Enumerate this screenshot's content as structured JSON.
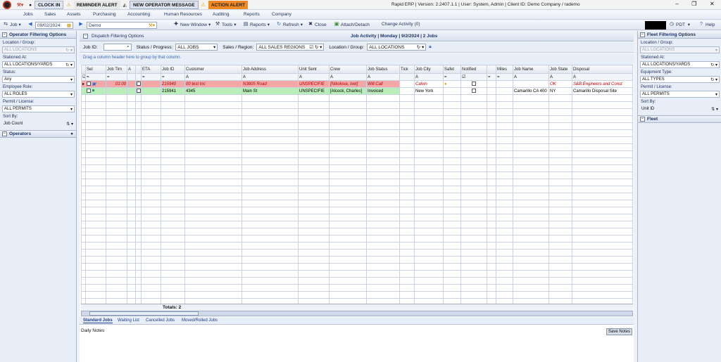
{
  "alerts": {
    "clock_in": "CLOCK IN",
    "reminder": "REMINDER ALERT",
    "new_operator": "NEW OPERATOR MESSAGE",
    "action": "ACTION ALERT"
  },
  "title_info": "Rapid ERP | Version: 2.2407.1.1 | User: System, Admin | Client ID: Demo Company / rademo",
  "menu": [
    "Jobs",
    "Sales",
    "Assets",
    "Purchasing",
    "Accounting",
    "Human Resources",
    "Auditing",
    "Reports",
    "Company"
  ],
  "toolbar": {
    "job": "Job",
    "date": "09/02/2024",
    "company": "Demo",
    "new_window": "New Window",
    "tools": "Tools",
    "reports": "Reports",
    "refresh": "Refresh",
    "close": "Close",
    "attach": "Attach/Detach",
    "change_activity": "Change Activity (0)",
    "tz": "PDT",
    "help": "Help"
  },
  "left_panel": {
    "title": "Operator Filtering Options",
    "location_label": "Location / Group:",
    "location_value": "ALL LOCATIONS",
    "stationed_label": "Stationed At:",
    "stationed_value": "ALL LOCATIONS/YARDS",
    "status_label": "Status:",
    "status_value": "Any",
    "role_label": "Employee Role:",
    "role_value": "ALL ROLES",
    "permit_label": "Permit / License:",
    "permit_value": "ALL PERMITS",
    "sort_label": "Sort By:",
    "sort_value": "Job Count",
    "operators": "Operators"
  },
  "right_panel": {
    "title": "Fleet Filtering Options",
    "location_label": "Location / Group:",
    "location_value": "ALL LOCATIONS",
    "stationed_label": "Stationed At:",
    "stationed_value": "ALL LOCATIONS/YARDS",
    "equip_label": "Equipment Type:",
    "equip_value": "ALL TYPES",
    "permit_label": "Permit / License:",
    "permit_value": "ALL PERMITS",
    "sort_label": "Sort By:",
    "sort_value": "Unit ID",
    "fleet": "Fleet"
  },
  "dispatch": {
    "title": "Dispatch Filtering Options",
    "activity": "Job Activity | Monday | 9/2/2024 | 2 Jobs",
    "job_id_label": "Job ID:",
    "status_label": "Status / Progress:",
    "status_value": "ALL JOBS",
    "region_label": "Sales / Region:",
    "region_value": "ALL SALES REGIONS",
    "locgroup_label": "Location / Group:",
    "locgroup_value": "ALL LOCATIONS",
    "drag_hint": "Drag a column header here to group by that column."
  },
  "columns": [
    "Sel",
    "Job Tim",
    "A",
    "ETA",
    "Job ID",
    "Customer",
    "Job Address",
    "Unit Sent",
    "Crew",
    "Job Status",
    "Tick",
    "Job City",
    "Safet",
    "Notified",
    "",
    "Miles",
    "Job Name",
    "Job State",
    "Disposal"
  ],
  "rows": [
    {
      "time": "01:00",
      "job_id": "215940",
      "customer": "00 test Inc",
      "address": "N3805 Road",
      "unit": "UNSPECIFIE",
      "crew": "[Nikolova, Ivet]",
      "status": "Will Call",
      "city": "Calvin",
      "name": "",
      "state": "OK",
      "disposal": "S&B Engineers and Const"
    },
    {
      "time": "",
      "job_id": "215941",
      "customer": "4345",
      "address": "Main St",
      "unit": "UNSPECIFIE",
      "crew": "[Alcock, Charles]",
      "status": "Invoiced",
      "city": "New York",
      "name": "Camarillo CA 400",
      "state": "NY",
      "disposal": "Camarillo Disposal Site"
    }
  ],
  "totals": "Totals: 2",
  "tabs": [
    "Standard Jobs",
    "Waiting List",
    "Cancelled Jobs",
    "Moved/Rolled Jobs"
  ],
  "notes_label": "Daily Notes",
  "save_notes": "Save Notes"
}
